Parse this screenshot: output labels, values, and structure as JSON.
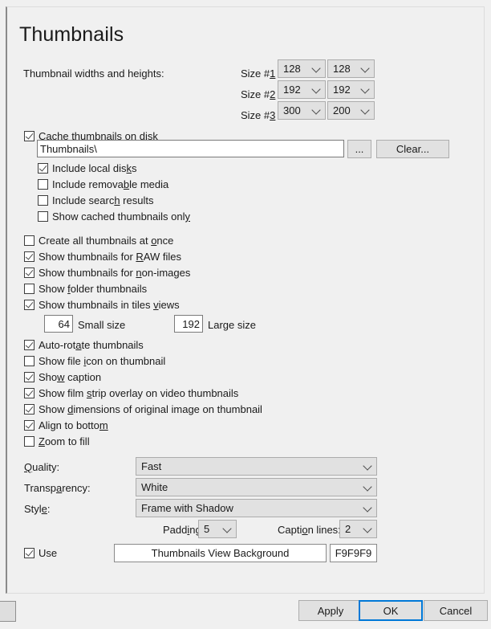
{
  "page": {
    "title": "Thumbnails"
  },
  "sizes": {
    "group_label": "Thumbnail widths and heights:",
    "rows": [
      {
        "label": "Size #1",
        "accel": "1",
        "width": "128",
        "height": "128"
      },
      {
        "label": "Size #2",
        "accel": "2",
        "width": "192",
        "height": "192"
      },
      {
        "label": "Size #3",
        "accel": "3",
        "width": "300",
        "height": "200"
      }
    ]
  },
  "cache": {
    "checkbox_label": "Cache thumbnails on disk",
    "checkbox_checked": true,
    "path_value": "Thumbnails\\",
    "browse_label": "...",
    "clear_label": "Clear...",
    "sub_options": [
      {
        "label": "Include local disks",
        "checked": true
      },
      {
        "label": "Include removable media",
        "checked": false
      },
      {
        "label": "Include search results",
        "checked": false
      },
      {
        "label": "Show cached thumbnails only",
        "checked": false
      }
    ]
  },
  "options_group_1": [
    {
      "label": "Create all thumbnails at once",
      "checked": false
    },
    {
      "label": "Show thumbnails for RAW files",
      "checked": true
    },
    {
      "label": "Show thumbnails for non-images",
      "checked": true
    },
    {
      "label": "Show folder thumbnails",
      "checked": false
    },
    {
      "label": "Show thumbnails in tiles views",
      "checked": true
    }
  ],
  "tile_sizes": {
    "small_value": "64",
    "small_label": "Small size",
    "large_value": "192",
    "large_label": "Large size"
  },
  "options_group_2": [
    {
      "label": "Auto-rotate thumbnails",
      "checked": true
    },
    {
      "label": "Show file icon on thumbnail",
      "checked": false
    },
    {
      "label": "Show caption",
      "checked": true
    },
    {
      "label": "Show film strip overlay on video thumbnails",
      "checked": true
    },
    {
      "label": "Show dimensions of original image on thumbnail",
      "checked": true
    },
    {
      "label": "Align to bottom",
      "checked": true
    },
    {
      "label": "Zoom to fill",
      "checked": false
    }
  ],
  "dropdowns": {
    "quality_label": "Quality:",
    "quality_value": "Fast",
    "transparency_label": "Transparency:",
    "transparency_value": "White",
    "style_label": "Style:",
    "style_value": "Frame with Shadow",
    "padding_label": "Padding:",
    "padding_value": "5",
    "caption_lines_label": "Caption lines:",
    "caption_lines_value": "2"
  },
  "background": {
    "use_label": "Use",
    "use_checked": true,
    "button_label": "Thumbnails View Background",
    "color_label": "F9F9F9",
    "color_hex": "#F9F9F9"
  },
  "footer": {
    "apply_label": "Apply",
    "ok_label": "OK",
    "cancel_label": "Cancel"
  }
}
